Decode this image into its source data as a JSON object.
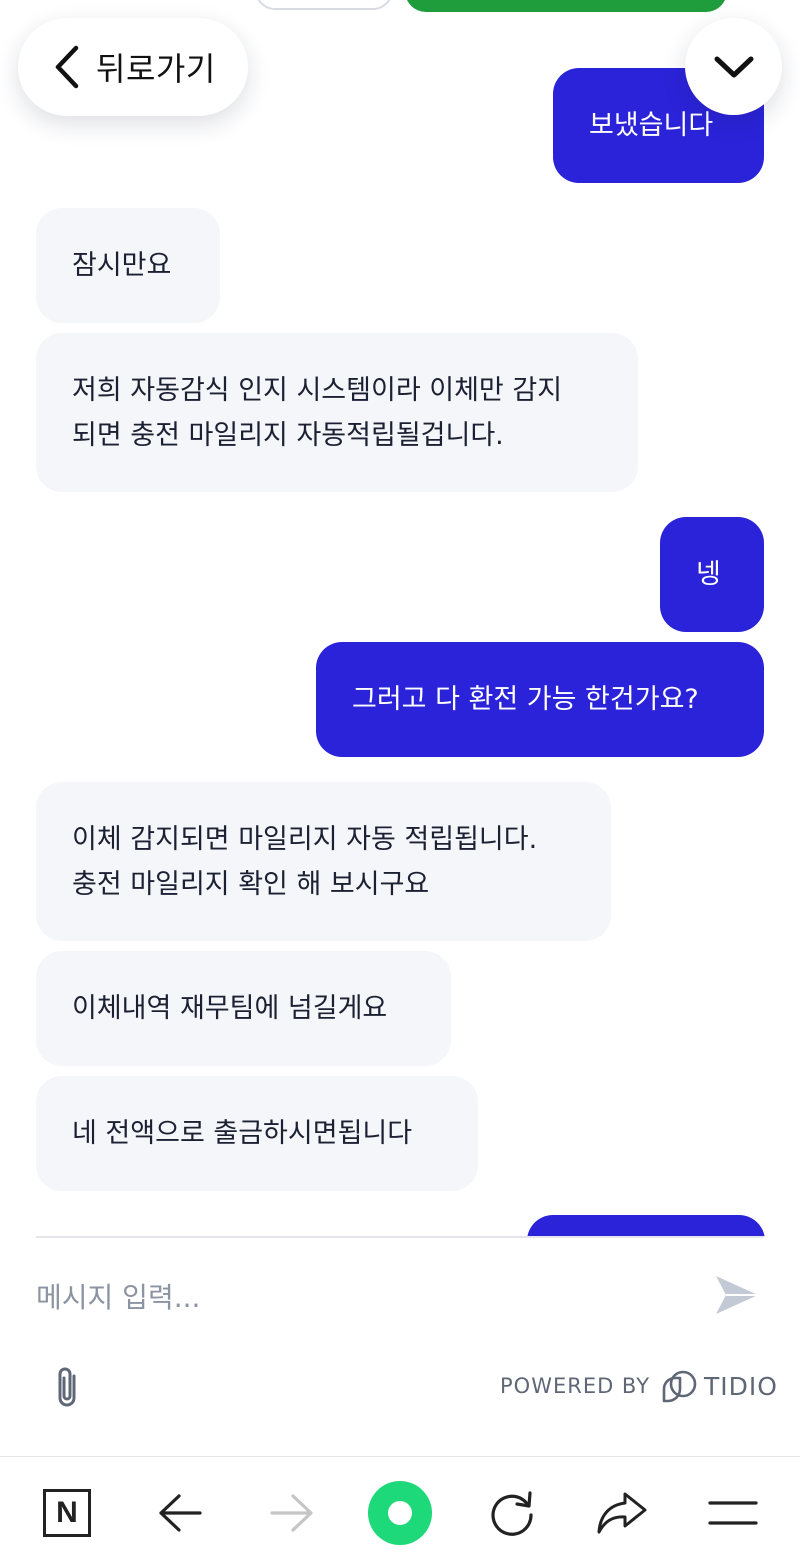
{
  "header": {
    "back_label": "뒤로가기"
  },
  "messages": [
    {
      "dir": "out",
      "text": "보냈습니다"
    },
    {
      "dir": "in",
      "text": "잠시만요"
    },
    {
      "dir": "in",
      "line1": "저희 자동감식 인지 시스템이라 이체만 감지",
      "line2": "되면 충전 마일리지 자동적립될겁니다."
    },
    {
      "dir": "out",
      "text": "넹"
    },
    {
      "dir": "out",
      "text": "그러고 다 환전 가능 한건가요?"
    },
    {
      "dir": "in",
      "line1": "이체 감지되면 마일리지 자동 적립됩니다.",
      "line2": "충전 마일리지 확인 해 보시구요"
    },
    {
      "dir": "in",
      "text": "이체내역 재무팀에 넘길게요"
    },
    {
      "dir": "in",
      "text": "네 전액으로 출금하시면됩니다"
    }
  ],
  "composer": {
    "placeholder": "메시지 입력..."
  },
  "footer": {
    "powered_by": "POWERED BY",
    "brand": "TIDIO"
  },
  "browser": {
    "logo_letter": "N"
  },
  "colors": {
    "outgoing_bubble": "#2b23d9",
    "incoming_bubble": "#f5f6f9",
    "home_button": "#1ed97a"
  }
}
